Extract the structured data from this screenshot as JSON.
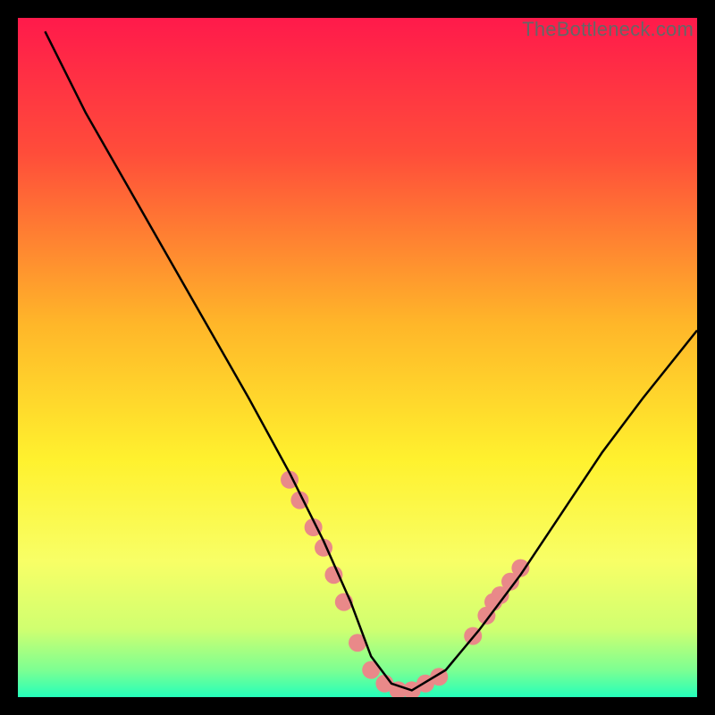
{
  "watermark": "TheBottleneck.com",
  "chart_data": {
    "type": "line",
    "title": "",
    "xlabel": "",
    "ylabel": "",
    "xlim": [
      0,
      100
    ],
    "ylim": [
      0,
      100
    ],
    "grid": false,
    "axes_visible": false,
    "gradient": {
      "stops": [
        {
          "offset": 0.0,
          "color": "#ff1a4b"
        },
        {
          "offset": 0.2,
          "color": "#ff4d3a"
        },
        {
          "offset": 0.45,
          "color": "#ffb629"
        },
        {
          "offset": 0.65,
          "color": "#fff12e"
        },
        {
          "offset": 0.8,
          "color": "#f8ff66"
        },
        {
          "offset": 0.9,
          "color": "#d0ff70"
        },
        {
          "offset": 0.96,
          "color": "#7dff92"
        },
        {
          "offset": 1.0,
          "color": "#24ffba"
        }
      ]
    },
    "series": [
      {
        "name": "bottleneck-curve",
        "color": "#000000",
        "x": [
          4,
          10,
          18,
          26,
          34,
          40,
          45,
          49,
          52,
          55,
          58,
          63,
          68,
          74,
          80,
          86,
          92,
          100
        ],
        "y": [
          98,
          86,
          72,
          58,
          44,
          33,
          23,
          14,
          6,
          2,
          1,
          4,
          10,
          18,
          27,
          36,
          44,
          54
        ]
      }
    ],
    "scatter": {
      "name": "highlight-dots",
      "color": "#e98989",
      "radius": 10,
      "points": [
        {
          "x": 40.0,
          "y": 32
        },
        {
          "x": 41.5,
          "y": 29
        },
        {
          "x": 43.5,
          "y": 25
        },
        {
          "x": 45.0,
          "y": 22
        },
        {
          "x": 46.5,
          "y": 18
        },
        {
          "x": 48.0,
          "y": 14
        },
        {
          "x": 50.0,
          "y": 8
        },
        {
          "x": 52.0,
          "y": 4
        },
        {
          "x": 54.0,
          "y": 2
        },
        {
          "x": 56.0,
          "y": 1
        },
        {
          "x": 58.0,
          "y": 1
        },
        {
          "x": 60.0,
          "y": 2
        },
        {
          "x": 62.0,
          "y": 3
        },
        {
          "x": 67.0,
          "y": 9
        },
        {
          "x": 69.0,
          "y": 12
        },
        {
          "x": 70.0,
          "y": 14
        },
        {
          "x": 71.0,
          "y": 15
        },
        {
          "x": 72.5,
          "y": 17
        },
        {
          "x": 74.0,
          "y": 19
        }
      ]
    }
  }
}
